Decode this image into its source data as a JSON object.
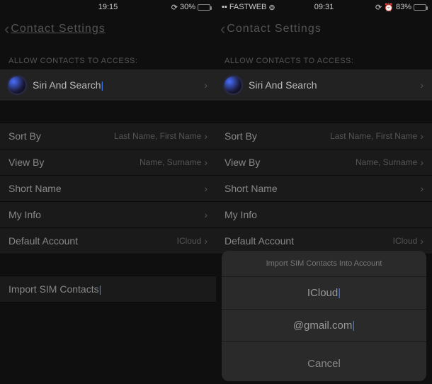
{
  "left": {
    "status": {
      "time": "19:15",
      "battery": "30%",
      "carrier": ""
    },
    "nav": {
      "title": "Contact Settings"
    },
    "section_header": "ALLOW CONTACTS TO ACCESS:",
    "siri": {
      "label": "Siri And Search"
    },
    "rows": {
      "sort_by": {
        "label": "Sort By",
        "value": "Last Name, First Name"
      },
      "view_by": {
        "label": "View By",
        "value": "Name, Surname"
      },
      "short_name": {
        "label": "Short Name",
        "value": ""
      },
      "my_info": {
        "label": "My Info",
        "value": ""
      },
      "default_account": {
        "label": "Default Account",
        "value": "ICloud"
      }
    },
    "import": {
      "label": "Import SIM Contacts"
    }
  },
  "right": {
    "status": {
      "time": "09:31",
      "battery": "83%",
      "carrier": "FASTWEB"
    },
    "nav": {
      "title": "Contact Settings"
    },
    "section_header": "ALLOW CONTACTS TO ACCESS:",
    "siri": {
      "label": "Siri And Search"
    },
    "rows": {
      "sort_by": {
        "label": "Sort By",
        "value": "Last Name, First Name"
      },
      "view_by": {
        "label": "View By",
        "value": "Name, Surname"
      },
      "short_name": {
        "label": "Short Name",
        "value": ""
      },
      "my_info": {
        "label": "My Info",
        "value": ""
      },
      "default_account": {
        "label": "Default Account",
        "value": "ICloud"
      }
    },
    "sheet": {
      "title": "Import SIM Contacts Into Account",
      "option_icloud": "ICloud",
      "option_gmail": "@gmail.com",
      "cancel": "Cancel"
    }
  }
}
